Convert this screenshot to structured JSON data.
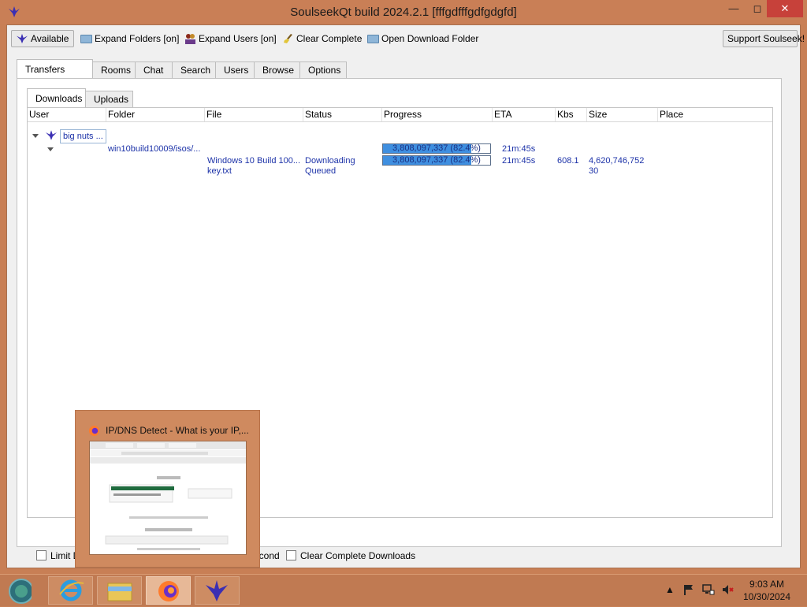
{
  "window": {
    "title": "SoulseekQt build 2024.2.1 [fffgdfffgdfgdgfd]"
  },
  "toolbar": {
    "available": "Available",
    "expand_folders": "Expand Folders [on]",
    "expand_users": "Expand Users [on]",
    "clear_complete": "Clear Complete",
    "open_download_folder": "Open Download Folder",
    "support": "Support Soulseek!"
  },
  "main_tabs": [
    "Transfers [1/0]",
    "Rooms",
    "Chat",
    "Search",
    "Users",
    "Browse",
    "Options"
  ],
  "sub_tabs": [
    "Downloads",
    "Uploads"
  ],
  "columns": [
    "User",
    "Folder",
    "File",
    "Status",
    "Progress",
    "ETA",
    "Kbs",
    "Size",
    "Place"
  ],
  "transfers": {
    "user": "big nuts ...",
    "folder": "win10build10009/isos/...",
    "folder_progress": {
      "text": "3,808,097,337 (82.4%)",
      "fraction": 0.824
    },
    "folder_eta": "21m:45s",
    "files": [
      {
        "file": "Windows 10 Build 100...",
        "status": "Downloading",
        "progress": "3,808,097,337 (82.4%)",
        "fraction": 0.824,
        "eta": "21m:45s",
        "kbs": "608.1",
        "size": "4,620,746,752"
      },
      {
        "file": "key.txt",
        "status": "Queued",
        "progress": "",
        "fraction": 0,
        "eta": "",
        "kbs": "",
        "size": "30"
      }
    ]
  },
  "bottom": {
    "limit_downloads": "Limit Do",
    "per_second": "econd",
    "clear_complete_downloads": "Clear Complete Downloads"
  },
  "thumbnail": {
    "title": "IP/DNS Detect - What is your IP,..."
  },
  "tray": {
    "time": "9:03 AM",
    "date": "10/30/2024"
  },
  "colors": {
    "titlebar": "#c97f56",
    "close": "#c7413a",
    "accent_text": "#1c32a8",
    "progress_fill": "#3f8fe0"
  }
}
